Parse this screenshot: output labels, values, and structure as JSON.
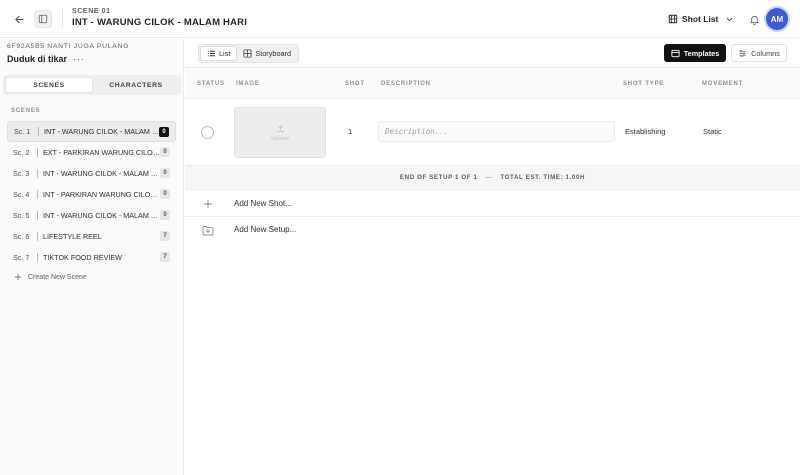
{
  "header": {
    "scene_kicker": "SCENE 01",
    "scene_title": "INT - WARUNG CILOK - MALAM HARI",
    "shotlist_label": "Shot List",
    "avatar_initials": "AM",
    "avatar_color": "#3b5bd6"
  },
  "sidebar": {
    "project_code": "6F92A5B5 NANTI JUGA PULANG",
    "project_name": "Duduk di tikar",
    "more_label": "···",
    "tabs": [
      {
        "label": "SCENES",
        "active": true
      },
      {
        "label": "CHARACTERS",
        "active": false
      }
    ],
    "scenes_label": "SCENES",
    "scenes": [
      {
        "num": "Sc. 1",
        "name": "INT - WARUNG CILOK - MALAM HARI",
        "count": "0",
        "active": true
      },
      {
        "num": "Sc. 2",
        "name": "EXT - PARKIRAN WARUNG CILOK - MALAM HARI",
        "count": "0",
        "active": false
      },
      {
        "num": "Sc. 3",
        "name": "INT - WARUNG CILOK - MALAM HARI",
        "count": "0",
        "active": false
      },
      {
        "num": "Sc. 4",
        "name": "INT - PARKIRAN WARUNG CILOK - MALAM HARI",
        "count": "0",
        "active": false
      },
      {
        "num": "Sc. 5",
        "name": "INT - WARUNG CILOK - MALAM HARI",
        "count": "0",
        "active": false
      },
      {
        "num": "Sc. 6",
        "name": "LIFESTYLE REEL",
        "count": "7",
        "active": false
      },
      {
        "num": "Sc. 7",
        "name": "TIKTOK FOOD REVIEW",
        "count": "7",
        "active": false
      }
    ],
    "create_scene_label": "Create New Scene"
  },
  "toolbar": {
    "list_label": "List",
    "storyboard_label": "Storyboard",
    "templates_label": "Templates",
    "columns_label": "Columns"
  },
  "table": {
    "headers": {
      "status": "STATUS",
      "image": "IMAGE",
      "shot": "SHOT",
      "description": "DESCRIPTION",
      "shot_type": "SHOT TYPE",
      "movement": "MOVEMENT"
    },
    "rows": [
      {
        "shot": "1",
        "upload_label": "Upload",
        "description_value": "",
        "description_placeholder": "Description...",
        "shot_type": "Establishing",
        "movement": "Static"
      }
    ],
    "setup_footer": {
      "end_label": "END OF SETUP 1 OF 1",
      "dash": "—",
      "total_label": "TOTAL EST. TIME: 1.00H"
    },
    "add_shot_label": "Add New Shot...",
    "add_setup_label": "Add New Setup..."
  }
}
